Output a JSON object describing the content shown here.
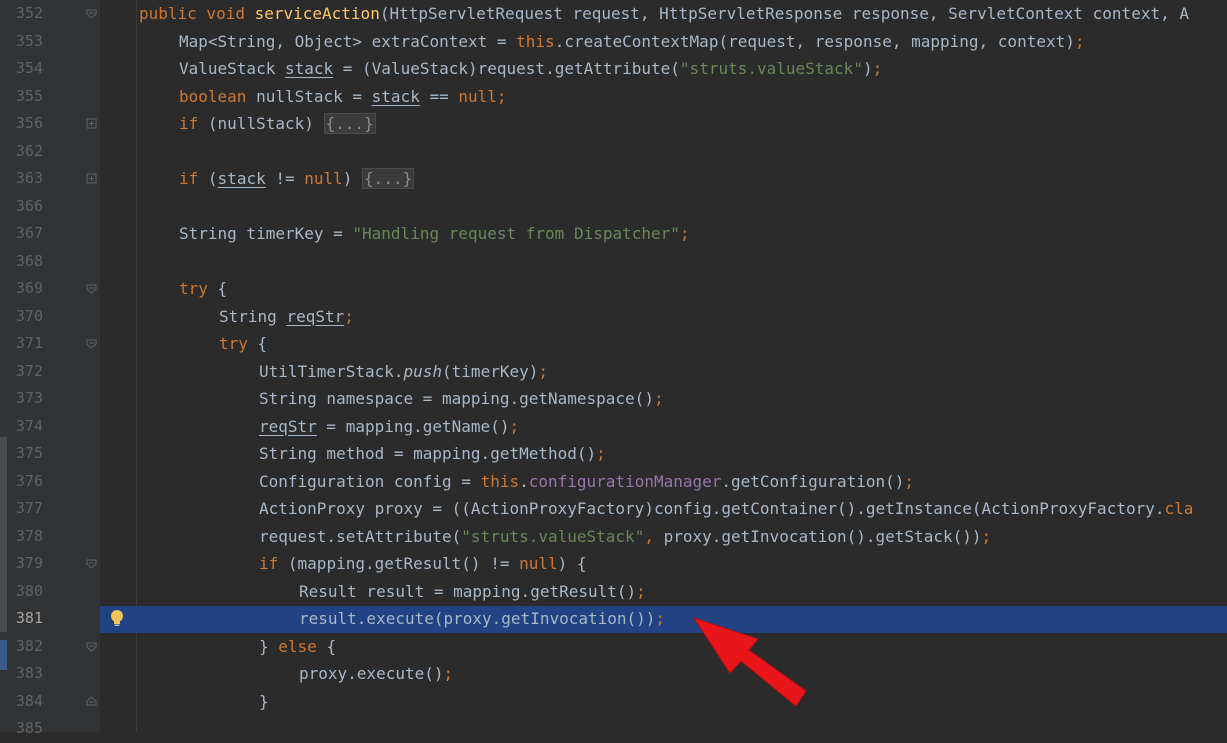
{
  "editor": {
    "current_line": "381",
    "lines": [
      {
        "num": "352",
        "fold": "open",
        "indent": 0,
        "tokens": [
          {
            "t": "public void ",
            "c": "kw"
          },
          {
            "t": "serviceAction",
            "c": "fn"
          },
          {
            "t": "(HttpServletRequest request, HttpServletResponse response, ServletContext context, A",
            "c": "p"
          }
        ]
      },
      {
        "num": "353",
        "indent": 1,
        "tokens": [
          {
            "t": "Map<String, Object> extraContext = ",
            "c": "p"
          },
          {
            "t": "this",
            "c": "kw"
          },
          {
            "t": ".createContextMap(request, response, mapping, context)",
            "c": "p"
          },
          {
            "t": ";",
            "c": "kw"
          }
        ]
      },
      {
        "num": "354",
        "indent": 1,
        "tokens": [
          {
            "t": "ValueStack ",
            "c": "p"
          },
          {
            "t": "stack",
            "c": "ul"
          },
          {
            "t": " = (ValueStack)request.getAttribute(",
            "c": "p"
          },
          {
            "t": "\"struts.valueStack\"",
            "c": "str"
          },
          {
            "t": ")",
            "c": "p"
          },
          {
            "t": ";",
            "c": "kw"
          }
        ]
      },
      {
        "num": "355",
        "indent": 1,
        "tokens": [
          {
            "t": "boolean ",
            "c": "kw"
          },
          {
            "t": "nullStack = ",
            "c": "p"
          },
          {
            "t": "stack",
            "c": "ul"
          },
          {
            "t": " == ",
            "c": "p"
          },
          {
            "t": "null",
            "c": "kw"
          },
          {
            "t": ";",
            "c": "kw"
          }
        ]
      },
      {
        "num": "356",
        "fold": "plus",
        "indent": 1,
        "tokens": [
          {
            "t": "if ",
            "c": "kw"
          },
          {
            "t": "(nullStack) ",
            "c": "p"
          },
          {
            "t": "{...}",
            "c": "fold"
          }
        ]
      },
      {
        "num": "362",
        "indent": 0,
        "tokens": []
      },
      {
        "num": "363",
        "fold": "plus",
        "indent": 1,
        "tokens": [
          {
            "t": "if ",
            "c": "kw"
          },
          {
            "t": "(",
            "c": "p"
          },
          {
            "t": "stack",
            "c": "ul"
          },
          {
            "t": " != ",
            "c": "p"
          },
          {
            "t": "null",
            "c": "kw"
          },
          {
            "t": ") ",
            "c": "p"
          },
          {
            "t": "{...}",
            "c": "fold"
          }
        ]
      },
      {
        "num": "366",
        "indent": 0,
        "tokens": []
      },
      {
        "num": "367",
        "indent": 1,
        "tokens": [
          {
            "t": "String timerKey = ",
            "c": "p"
          },
          {
            "t": "\"Handling request from Dispatcher\"",
            "c": "str"
          },
          {
            "t": ";",
            "c": "kw"
          }
        ]
      },
      {
        "num": "368",
        "indent": 0,
        "tokens": []
      },
      {
        "num": "369",
        "fold": "open",
        "indent": 1,
        "tokens": [
          {
            "t": "try ",
            "c": "kw"
          },
          {
            "t": "{",
            "c": "p"
          }
        ]
      },
      {
        "num": "370",
        "indent": 2,
        "tokens": [
          {
            "t": "String ",
            "c": "p"
          },
          {
            "t": "reqStr",
            "c": "ul"
          },
          {
            "t": ";",
            "c": "kw"
          }
        ]
      },
      {
        "num": "371",
        "fold": "open",
        "indent": 2,
        "tokens": [
          {
            "t": "try ",
            "c": "kw"
          },
          {
            "t": "{",
            "c": "p"
          }
        ]
      },
      {
        "num": "372",
        "indent": 3,
        "tokens": [
          {
            "t": "UtilTimerStack.",
            "c": "p"
          },
          {
            "t": "push",
            "c": "ital"
          },
          {
            "t": "(timerKey)",
            "c": "p"
          },
          {
            "t": ";",
            "c": "kw"
          }
        ]
      },
      {
        "num": "373",
        "indent": 3,
        "tokens": [
          {
            "t": "String namespace = mapping.getNamespace()",
            "c": "p"
          },
          {
            "t": ";",
            "c": "kw"
          }
        ]
      },
      {
        "num": "374",
        "indent": 3,
        "tokens": [
          {
            "t": "reqStr",
            "c": "ul"
          },
          {
            "t": " = mapping.getName()",
            "c": "p"
          },
          {
            "t": ";",
            "c": "kw"
          }
        ]
      },
      {
        "num": "375",
        "indent": 3,
        "tokens": [
          {
            "t": "String method = mapping.getMethod()",
            "c": "p"
          },
          {
            "t": ";",
            "c": "kw"
          }
        ]
      },
      {
        "num": "376",
        "indent": 3,
        "tokens": [
          {
            "t": "Configuration config = ",
            "c": "p"
          },
          {
            "t": "this",
            "c": "kw"
          },
          {
            "t": ".",
            "c": "p"
          },
          {
            "t": "configurationManager",
            "c": "fld"
          },
          {
            "t": ".getConfiguration()",
            "c": "p"
          },
          {
            "t": ";",
            "c": "kw"
          }
        ]
      },
      {
        "num": "377",
        "indent": 3,
        "tokens": [
          {
            "t": "ActionProxy proxy = ((ActionProxyFactory)config.getContainer().getInstance(ActionProxyFactory.",
            "c": "p"
          },
          {
            "t": "cla",
            "c": "kw"
          }
        ]
      },
      {
        "num": "378",
        "indent": 3,
        "tokens": [
          {
            "t": "request.setAttribute(",
            "c": "p"
          },
          {
            "t": "\"struts.valueStack\"",
            "c": "str"
          },
          {
            "t": ",",
            "c": "kw"
          },
          {
            "t": " proxy.getInvocation().getStack())",
            "c": "p"
          },
          {
            "t": ";",
            "c": "kw"
          }
        ]
      },
      {
        "num": "379",
        "fold": "open",
        "indent": 3,
        "tokens": [
          {
            "t": "if ",
            "c": "kw"
          },
          {
            "t": "(mapping.getResult() != ",
            "c": "p"
          },
          {
            "t": "null",
            "c": "kw"
          },
          {
            "t": ") {",
            "c": "p"
          }
        ]
      },
      {
        "num": "380",
        "indent": 4,
        "tokens": [
          {
            "t": "Result result = mapping.getResult()",
            "c": "p"
          },
          {
            "t": ";",
            "c": "kw"
          }
        ]
      },
      {
        "num": "381",
        "indent": 4,
        "current": true,
        "bulb": true,
        "tokens": [
          {
            "t": "result.execute(proxy.getInvocation())",
            "c": "p"
          },
          {
            "t": ";",
            "c": "kw"
          }
        ]
      },
      {
        "num": "382",
        "fold": "open",
        "indent": 3,
        "tokens": [
          {
            "t": "} ",
            "c": "p"
          },
          {
            "t": "else ",
            "c": "kw"
          },
          {
            "t": "{",
            "c": "p"
          }
        ]
      },
      {
        "num": "383",
        "indent": 4,
        "tokens": [
          {
            "t": "proxy.execute()",
            "c": "p"
          },
          {
            "t": ";",
            "c": "kw"
          }
        ]
      },
      {
        "num": "384",
        "fold": "close",
        "indent": 3,
        "tokens": [
          {
            "t": "}",
            "c": "p"
          }
        ]
      },
      {
        "num": "385",
        "indent": 0,
        "tokens": []
      }
    ]
  },
  "annotation": {
    "color": "#e8161b",
    "type": "arrow",
    "points_to_line": "381"
  },
  "colors": {
    "keyword": "#cc7832",
    "function": "#ffc66d",
    "string": "#6a8759",
    "field": "#9876aa",
    "plain": "#a9b7c6",
    "selection": "#214283"
  }
}
